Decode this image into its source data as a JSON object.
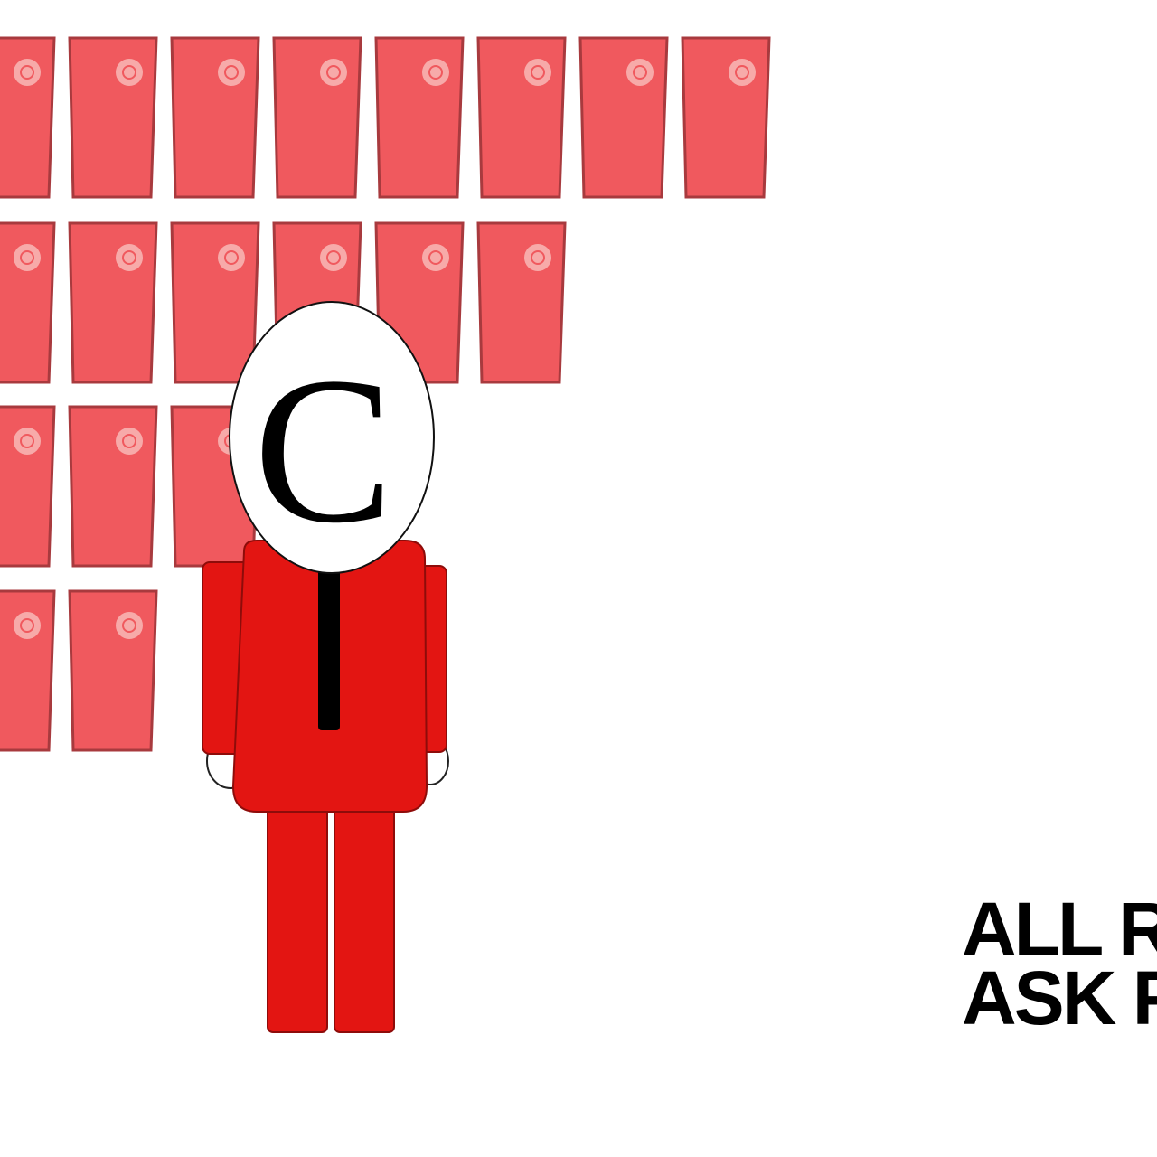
{
  "colors": {
    "background": "#ffffff",
    "door_fill": "#f0595e",
    "door_stroke": "#a83a3e",
    "door_badge": "#f7aaa9",
    "suit": "#e31512",
    "suit_stroke": "#8e0c0a",
    "tie": "#000000",
    "head": "#ffffff",
    "head_letter": "#000000",
    "text": "#000000"
  },
  "doors": {
    "row_counts": [
      8,
      6,
      3,
      2
    ],
    "icon": "copyright-symbol"
  },
  "figure": {
    "head_letter": "C",
    "icon": "copyright-person"
  },
  "caption": {
    "line1": "ALL R",
    "line2": "ASK F"
  }
}
